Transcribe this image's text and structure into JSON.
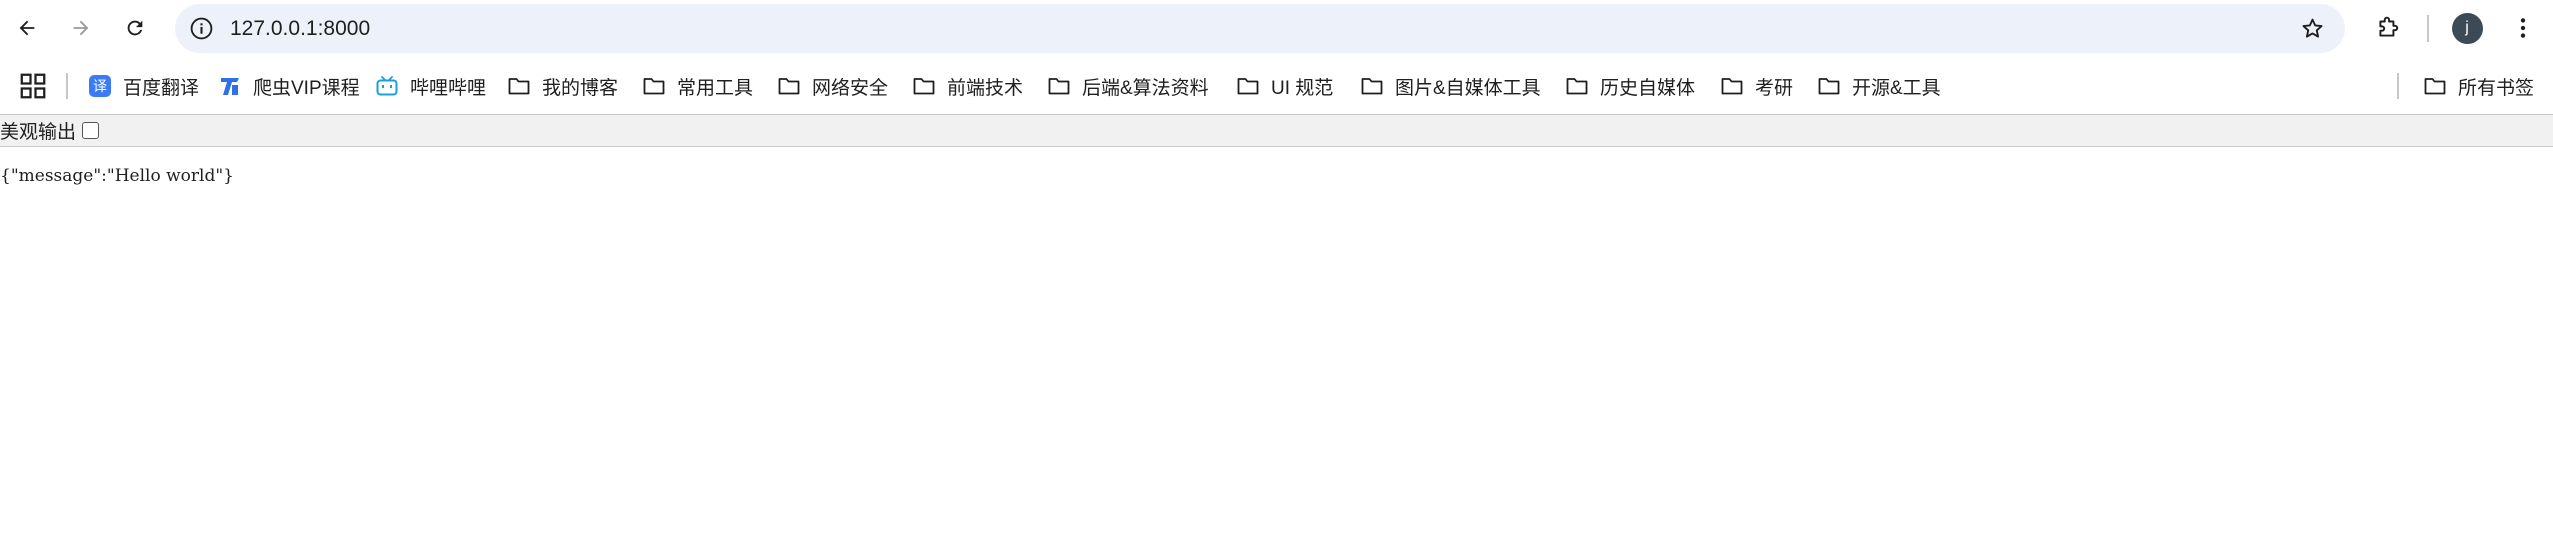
{
  "toolbar": {
    "url": "127.0.0.1:8000",
    "profile_initial": "j",
    "icons": [
      "back-arrow-icon",
      "forward-arrow-icon",
      "reload-icon",
      "info-icon",
      "star-icon",
      "puzzle-icon",
      "kebab-menu-icon"
    ]
  },
  "bookmarks": {
    "items": [
      {
        "label": "百度翻译",
        "icon": "baidu-translate-icon",
        "color": "#3b7cf6"
      },
      {
        "label": "爬虫VIP课程",
        "icon": "spider-course-icon",
        "color": "#2f6fe8"
      },
      {
        "label": "哔哩哔哩",
        "icon": "bilibili-icon",
        "color": "#19a0d6"
      },
      {
        "label": "我的博客",
        "icon": "folder-icon"
      },
      {
        "label": "常用工具",
        "icon": "folder-icon"
      },
      {
        "label": "网络安全",
        "icon": "folder-icon"
      },
      {
        "label": "前端技术",
        "icon": "folder-icon"
      },
      {
        "label": "后端&算法资料",
        "icon": "folder-icon"
      },
      {
        "label": "UI 规范",
        "icon": "folder-icon"
      },
      {
        "label": "图片&自媒体工具",
        "icon": "folder-icon"
      },
      {
        "label": "历史自媒体",
        "icon": "folder-icon"
      },
      {
        "label": "考研",
        "icon": "folder-icon"
      },
      {
        "label": "开源&工具",
        "icon": "folder-icon"
      }
    ],
    "all_bookmarks": "所有书签"
  },
  "page": {
    "pretty_print_label": "美观输出",
    "pretty_print_checked": false,
    "json_text": "{\"message\":\"Hello world\"}"
  }
}
